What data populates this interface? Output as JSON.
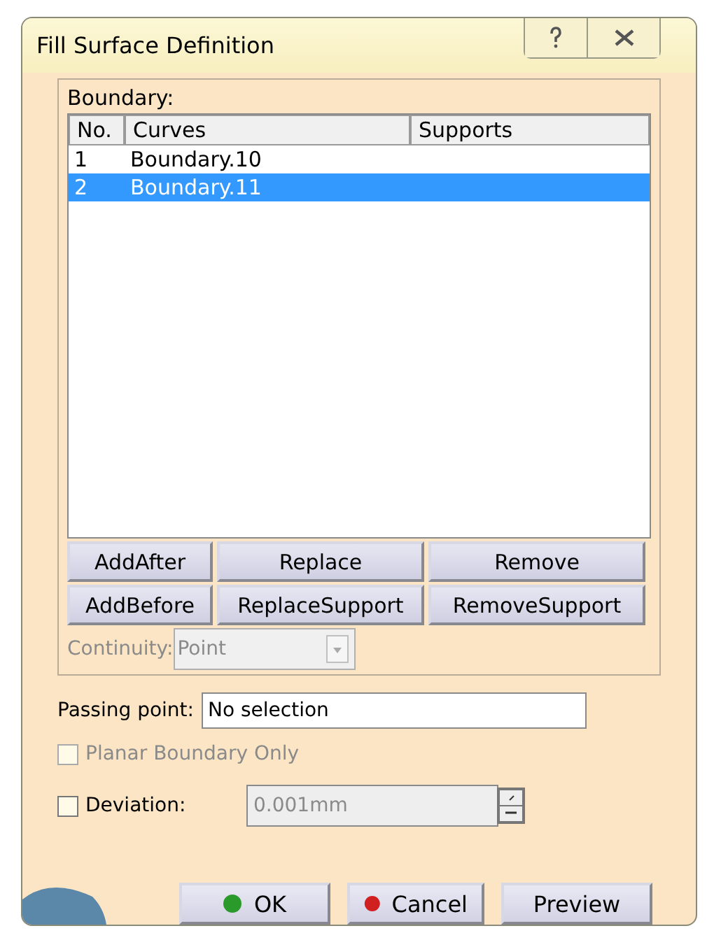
{
  "window": {
    "title": "Fill Surface Definition"
  },
  "boundary": {
    "label": "Boundary:",
    "columns": [
      "No.",
      "Curves",
      "Supports"
    ],
    "rows": [
      {
        "no": "1",
        "curve": "Boundary.10",
        "selected": false
      },
      {
        "no": "2",
        "curve": "Boundary.11",
        "selected": true
      }
    ]
  },
  "edit_buttons": [
    [
      "AddAfter",
      "Replace",
      "Remove"
    ],
    [
      "AddBefore",
      "ReplaceSupport",
      "RemoveSupport"
    ]
  ],
  "continuity": {
    "label": "Continuity:",
    "value": "Point",
    "disabled": true
  },
  "passing_point": {
    "label": "Passing point:",
    "value": "No selection"
  },
  "planar": {
    "label": "Planar Boundary Only",
    "checked": false,
    "disabled": true
  },
  "deviation": {
    "label": "Deviation:",
    "checked": false,
    "value": "0.001mm",
    "disabled": true
  },
  "actions": [
    {
      "label": "OK",
      "kind": "ok"
    },
    {
      "label": "Cancel",
      "kind": "cancel"
    },
    {
      "label": "Preview",
      "kind": "plain"
    }
  ]
}
